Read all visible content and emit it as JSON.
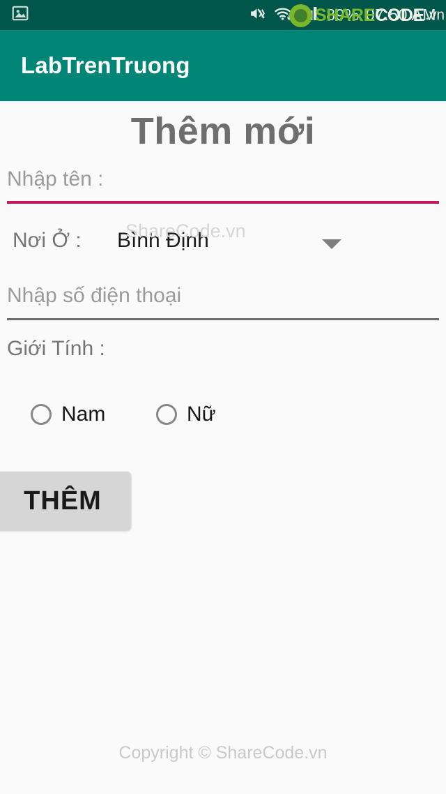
{
  "statusbar": {
    "notification_icon": "image-icon",
    "mute_icon": "mute-icon",
    "wifi_icon": "wifi-icon",
    "signal_icon": "signal-bars-icon",
    "battery_text": "89%",
    "clock_text": "07:50 AM",
    "bg_color": "#00564B"
  },
  "watermark": {
    "logo_icon": "sharecode-logo-icon",
    "share_text": "SHARE",
    "code_text": "CODE",
    "vn_text": ".vn",
    "inline_text": "ShareCode.vn",
    "brand_green": "#7AB829"
  },
  "toolbar": {
    "title": "LabTrenTruong",
    "bg_color": "#008577"
  },
  "form": {
    "screen_title": "Thêm mới",
    "name_field": {
      "placeholder": "Nhập tên :",
      "value": "",
      "underline_color": "#C2185B"
    },
    "place_row": {
      "label": "Nơi Ở :",
      "selected": "Bình Định",
      "caret_icon": "chevron-down-icon"
    },
    "phone_field": {
      "placeholder": "Nhập số điện thoại",
      "value": "",
      "underline_color": "#6E6E6E"
    },
    "gender": {
      "label": "Giới Tính :",
      "options": [
        {
          "label": "Nam",
          "checked": false
        },
        {
          "label": "Nữ",
          "checked": false
        }
      ]
    },
    "submit_label": "THÊM"
  },
  "footer": {
    "copyright": "Copyright © ShareCode.vn"
  }
}
